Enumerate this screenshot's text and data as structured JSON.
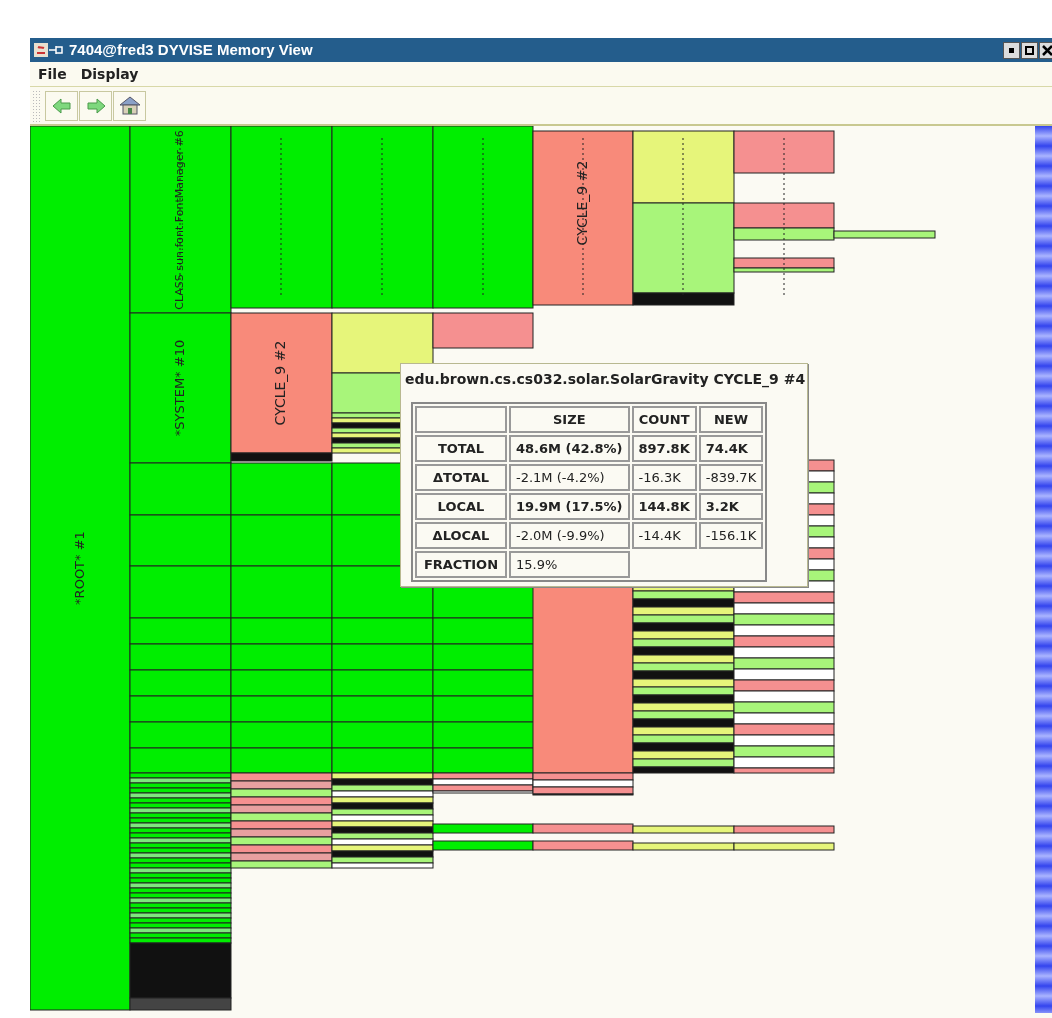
{
  "window": {
    "title": "7404@fred3 DYVISE Memory View"
  },
  "menu": [
    {
      "label": "File"
    },
    {
      "label": "Display"
    }
  ],
  "map": {
    "labels": [
      "*ROOT* #1",
      "CLASS sun.font.FontManager #6",
      "*SYSTEM* #10",
      "CYCLE_9 #2",
      "CYCLE_9 #2"
    ]
  },
  "tooltip": {
    "title": "edu.brown.cs.cs032.solar.SolarGravity CYCLE_9 #4",
    "columns": [
      "SIZE",
      "COUNT",
      "NEW"
    ],
    "rows": [
      {
        "label": "TOTAL",
        "bold": true,
        "cells": [
          "48.6M (42.8%)",
          "897.8K",
          "74.4K"
        ]
      },
      {
        "label": "ΔTOTAL",
        "bold": false,
        "cells": [
          "-2.1M (-4.2%)",
          "-16.3K",
          "-839.7K"
        ]
      },
      {
        "label": "LOCAL",
        "bold": true,
        "cells": [
          "19.9M (17.5%)",
          "144.8K",
          "3.2K"
        ]
      },
      {
        "label": "ΔLOCAL",
        "bold": false,
        "cells": [
          "-2.0M (-9.9%)",
          "-14.4K",
          "-156.1K"
        ]
      },
      {
        "label": "FRACTION",
        "bold": false,
        "cells": [
          "15.9%"
        ]
      }
    ]
  }
}
